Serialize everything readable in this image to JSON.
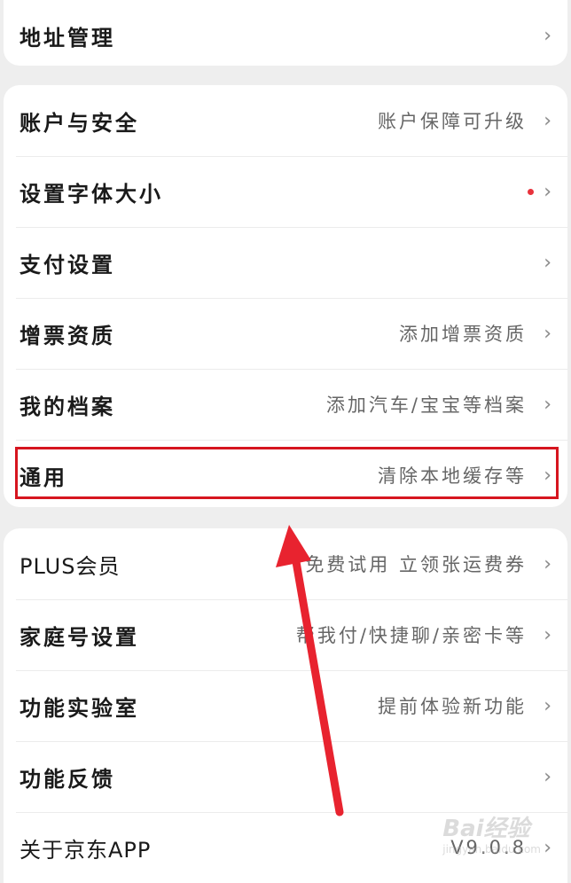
{
  "groups": [
    {
      "rows": [
        {
          "title": "地址管理",
          "hint": ""
        }
      ]
    },
    {
      "rows": [
        {
          "title": "账户与安全",
          "hint": "账户保障可升级"
        },
        {
          "title": "设置字体大小",
          "hint": ""
        },
        {
          "title": "支付设置",
          "hint": ""
        },
        {
          "title": "增票资质",
          "hint": "添加增票资质"
        },
        {
          "title": "我的档案",
          "hint": "添加汽车/宝宝等档案"
        },
        {
          "title": "通用",
          "hint": "清除本地缓存等"
        }
      ]
    },
    {
      "rows": [
        {
          "title": "PLUS会员",
          "hint": "免费试用 立领张运费券"
        },
        {
          "title": "家庭号设置",
          "hint": "帮我付/快捷聊/亲密卡等"
        },
        {
          "title": "功能实验室",
          "hint": "提前体验新功能"
        },
        {
          "title": "功能反馈",
          "hint": ""
        },
        {
          "title": "关于京东APP",
          "hint": "V9.0.8"
        }
      ]
    }
  ],
  "chevron": "›",
  "colors": {
    "highlight": "#d6151f",
    "arrow": "#e8232f",
    "dot": "#e8323c"
  },
  "watermark": {
    "logo": "Bai经验",
    "sub": "jingyan.baidu.com"
  }
}
